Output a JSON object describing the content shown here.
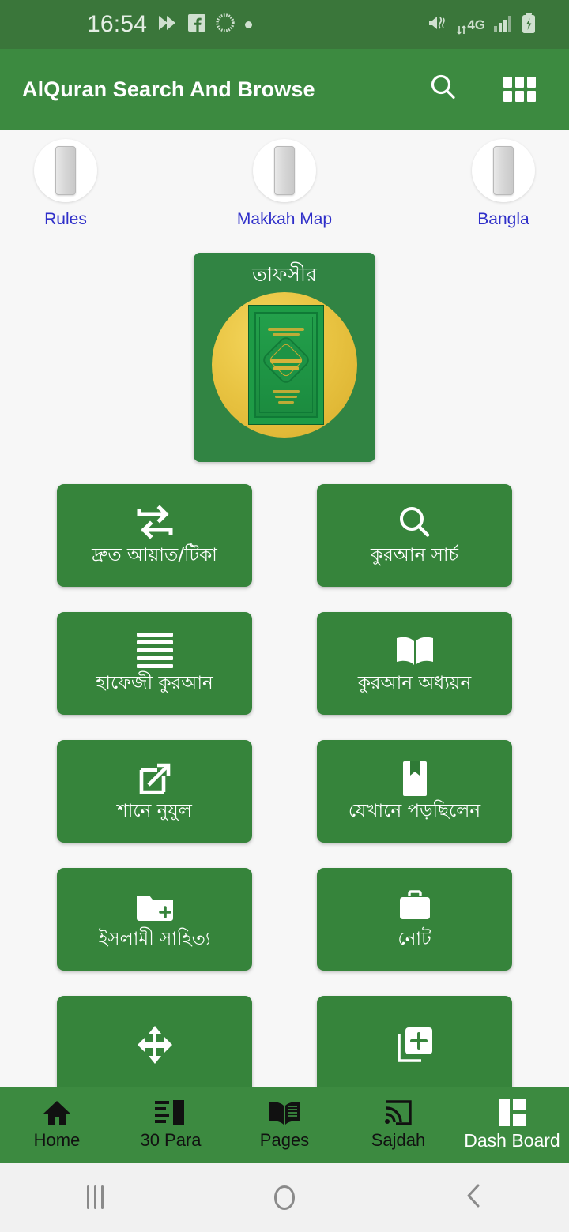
{
  "status_bar": {
    "time": "16:54",
    "left_icons": [
      "play-badge-icon",
      "facebook-icon",
      "sunburst-icon",
      "dot-icon"
    ],
    "network_type": "4G",
    "right_icons": [
      "mute-vibrate-icon",
      "data-transfer-icon",
      "signal-bars-icon",
      "battery-charging-icon"
    ],
    "background": "#3a763a"
  },
  "app_bar": {
    "title": "AlQuran Search And Browse",
    "search_icon": "search-icon",
    "apps_icon": "apps-grid-icon",
    "background": "#3c8a40"
  },
  "toggles": [
    {
      "label": "Rules",
      "icon": "book-spine-icon"
    },
    {
      "label": "Makkah Map",
      "icon": "book-spine-icon"
    },
    {
      "label": "Bangla",
      "icon": "book-spine-icon"
    }
  ],
  "toggle_label_color": "#2f2fc9",
  "tafsir_card": {
    "title": "তাফসীর",
    "image": "quran-book-on-gold-circle",
    "background": "#318443"
  },
  "features": [
    {
      "label": "দ্রুত আয়াত/টিকা",
      "icon": "repeat-arrows-icon"
    },
    {
      "label": "কুরআন সার্চ",
      "icon": "search-icon"
    },
    {
      "label": "হাফেজী কুরআন",
      "icon": "list-lines-icon"
    },
    {
      "label": "কুরআন অধ্যয়ন",
      "icon": "open-book-icon"
    },
    {
      "label": "শানে নুযুল",
      "icon": "external-link-icon"
    },
    {
      "label": "যেখানে পড়ছিলেন",
      "icon": "bookmark-icon"
    },
    {
      "label": "ইসলামী সাহিত্য",
      "icon": "folder-add-icon"
    },
    {
      "label": "নোট",
      "icon": "briefcase-icon"
    },
    {
      "label": "",
      "icon": "move-arrows-icon"
    },
    {
      "label": "",
      "icon": "library-add-icon"
    }
  ],
  "feature_button_color": "#36843b",
  "bottom_nav": {
    "items": [
      {
        "label": "Home",
        "icon": "home-icon",
        "active": false
      },
      {
        "label": "30 Para",
        "icon": "para-list-icon",
        "active": false
      },
      {
        "label": "Pages",
        "icon": "open-book-icon",
        "active": false
      },
      {
        "label": "Sajdah",
        "icon": "cast-icon",
        "active": false
      },
      {
        "label": "Dash Board",
        "icon": "dashboard-grid-icon",
        "active": true
      }
    ],
    "background": "#3c8a40"
  },
  "system_nav": {
    "recents": "recents-icon",
    "home": "home-circle-icon",
    "back": "back-chevron-icon"
  }
}
